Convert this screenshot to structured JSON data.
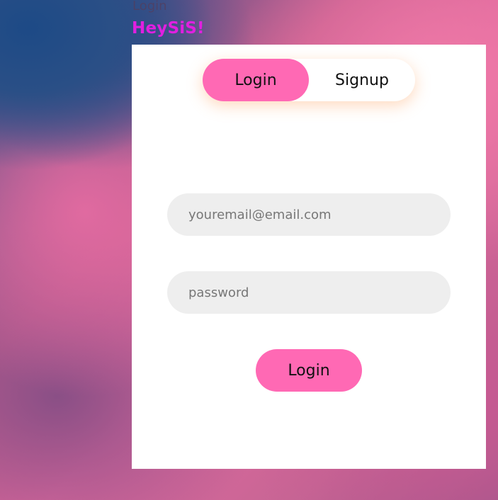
{
  "header": {
    "top_label": "Login",
    "brand": "HeySiS!"
  },
  "toggle": {
    "login_label": "Login",
    "signup_label": "Signup",
    "active": "Login"
  },
  "form": {
    "email_placeholder": "youremail@email.com",
    "email_value": "",
    "password_placeholder": "password",
    "password_value": "",
    "submit_label": "Login"
  },
  "colors": {
    "accent": "#ff69b4",
    "brand": "#e11fe0",
    "field_bg": "#eeeeee",
    "card_bg": "#ffffff"
  }
}
